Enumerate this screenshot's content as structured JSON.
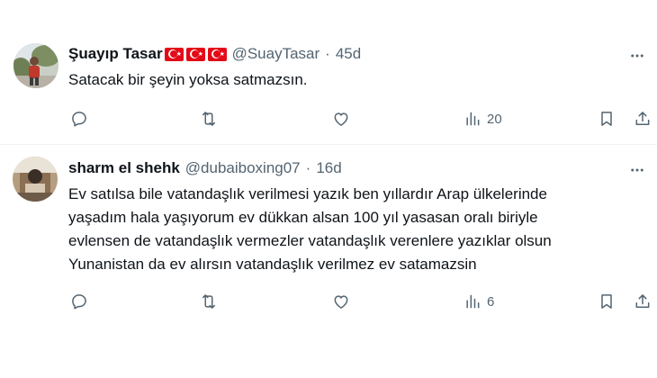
{
  "tweets": [
    {
      "name": "Şuayıp Tasar",
      "flags": [
        "🇹🇷",
        "🇹🇷",
        "🇹🇷"
      ],
      "handle": "@SuayTasar",
      "dot": "·",
      "age": "45d",
      "lines": [
        "Satacak bir şeyin yoksa satmazsın."
      ],
      "views": "20"
    },
    {
      "name": "sharm el shehk",
      "handle": "@dubaiboxing07",
      "dot": "·",
      "age": "16d",
      "lines": [
        "Ev satılsa bile vatandaşlık verilmesi yazık ben yıllardır Arap ülkelerinde",
        "yaşadım hala yaşıyorum ev dükkan alsan 100 yıl yasasan oralı biriyle",
        "evlensen de vatandaşlık vermezler vatandaşlık verenlere yazıklar olsun",
        "Yunanistan da ev alırsın vatandaşlık verilmez ev satamazsin"
      ],
      "views": "6"
    }
  ],
  "colors": {
    "text": "#0f1419",
    "secondary": "#536471",
    "divider": "#eff3f4",
    "flag_red": "#e30a17"
  },
  "icons": [
    "more-icon",
    "reply-icon",
    "retweet-icon",
    "like-icon",
    "views-icon",
    "bookmark-icon",
    "share-icon"
  ]
}
